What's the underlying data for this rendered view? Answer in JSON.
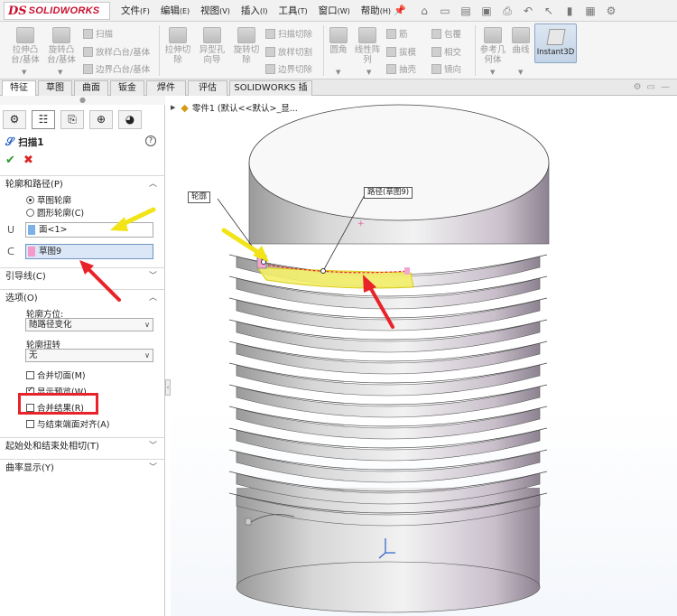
{
  "app": {
    "brand_ds": "DS",
    "brand_name": "SOLIDWORKS"
  },
  "menu": {
    "items": [
      {
        "label": "文件",
        "key": "(F)"
      },
      {
        "label": "编辑",
        "key": "(E)"
      },
      {
        "label": "视图",
        "key": "(V)"
      },
      {
        "label": "插入",
        "key": "(I)"
      },
      {
        "label": "工具",
        "key": "(T)"
      },
      {
        "label": "窗口",
        "key": "(W)"
      },
      {
        "label": "帮助",
        "key": "(H)"
      }
    ],
    "pin_icon": "pin-icon"
  },
  "ribbon": {
    "extrude_boss": "拉伸凸\n台/基体",
    "revolve_boss": "旋转凸\n台/基体",
    "sweep": "扫描",
    "loft": "放样凸台/基体",
    "boundary": "边界凸台/基体",
    "extrude_cut": "拉伸切\n除",
    "hole_wizard": "异型孔\n向导",
    "revolve_cut": "旋转切\n除",
    "swept_cut": "扫描切除",
    "lofted_cut": "放样切割",
    "boundary_cut": "边界切除",
    "fillet": "圆角",
    "linear_pattern": "线性阵\n列",
    "rib": "筋",
    "draft": "拔模",
    "shell": "抽壳",
    "wrap": "包覆",
    "intersect": "相交",
    "mirror": "镜向",
    "ref_geometry": "参考几\n何体",
    "curves": "曲线",
    "instant3d": "Instant3D"
  },
  "tabs": [
    "特征",
    "草图",
    "曲面",
    "钣金",
    "焊件",
    "评估",
    "SOLIDWORKS 插件"
  ],
  "tree": {
    "part": "零件1  (默认<<默认>_显..."
  },
  "property_manager": {
    "title": "扫描1",
    "sections": {
      "profile_path": "轮廓和路径(P)",
      "guide_curves": "引导线(C)",
      "options": "选项(O)",
      "tangency": "起始处和结束处相切(T)",
      "curvature": "曲率显示(Y)"
    },
    "radio_sketch_profile": "草图轮廓",
    "radio_circular_profile": "圆形轮廓(C)",
    "profile_value": "面<1>",
    "path_value": "草图9",
    "orientation_label": "轮廓方位:",
    "orientation_value": "随路径变化",
    "twist_label": "轮廓扭转",
    "twist_value": "无",
    "merge_tangent": "合并切面(M)",
    "show_preview": "显示预览(W)",
    "merge_result": "合并结果(R)",
    "align_end_faces": "与结束端面对齐(A)"
  },
  "callouts": {
    "profile": "轮廓",
    "path": "路径(草图9)"
  },
  "colors": {
    "accent_blue": "#2a62c6",
    "highlight_red": "#e8232a",
    "annotation_yellow": "#f2e416",
    "brand_red": "#c8102e"
  }
}
